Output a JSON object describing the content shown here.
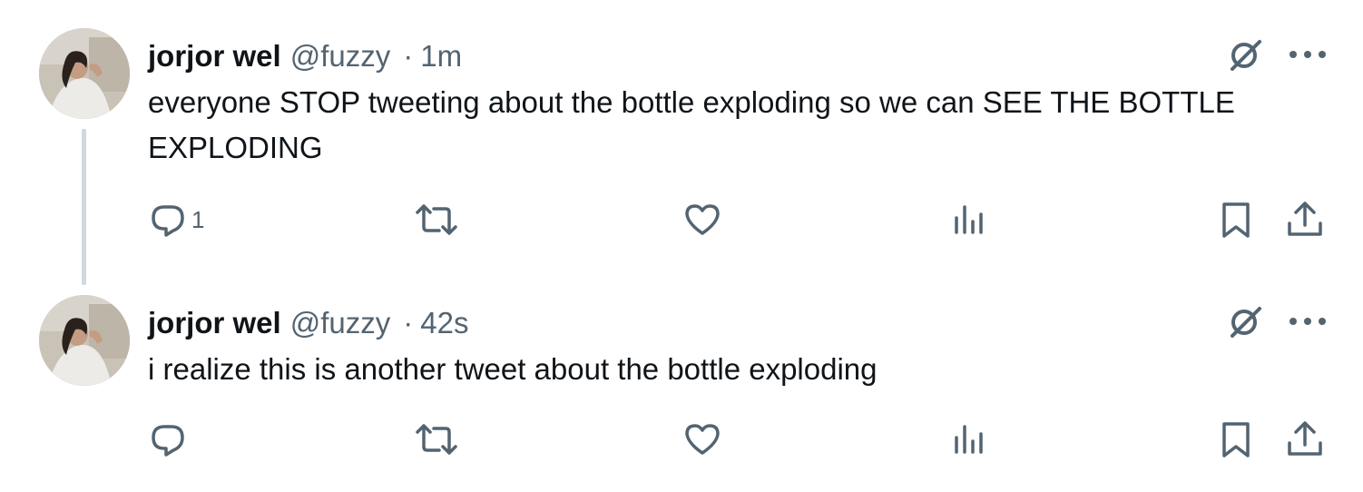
{
  "tweets": [
    {
      "display_name": "jorjor wel",
      "handle": "@fuzzy",
      "separator": "·",
      "time": "1m",
      "text": "everyone STOP tweeting about the bottle exploding so we can SEE THE BOTTLE EXPLODING",
      "reply_count": "1"
    },
    {
      "display_name": "jorjor wel",
      "handle": "@fuzzy",
      "separator": "·",
      "time": "42s",
      "text": "i realize this is another tweet about the bottle exploding",
      "reply_count": ""
    }
  ],
  "colors": {
    "text_primary": "#0f1419",
    "text_secondary": "#536471",
    "thread_line": "#cfd9de",
    "background": "#ffffff"
  },
  "icons": {
    "grok": "grok-icon",
    "more": "more-icon",
    "reply": "reply-icon",
    "retweet": "retweet-icon",
    "like": "heart-icon",
    "views": "views-icon",
    "bookmark": "bookmark-icon",
    "share": "share-icon"
  }
}
